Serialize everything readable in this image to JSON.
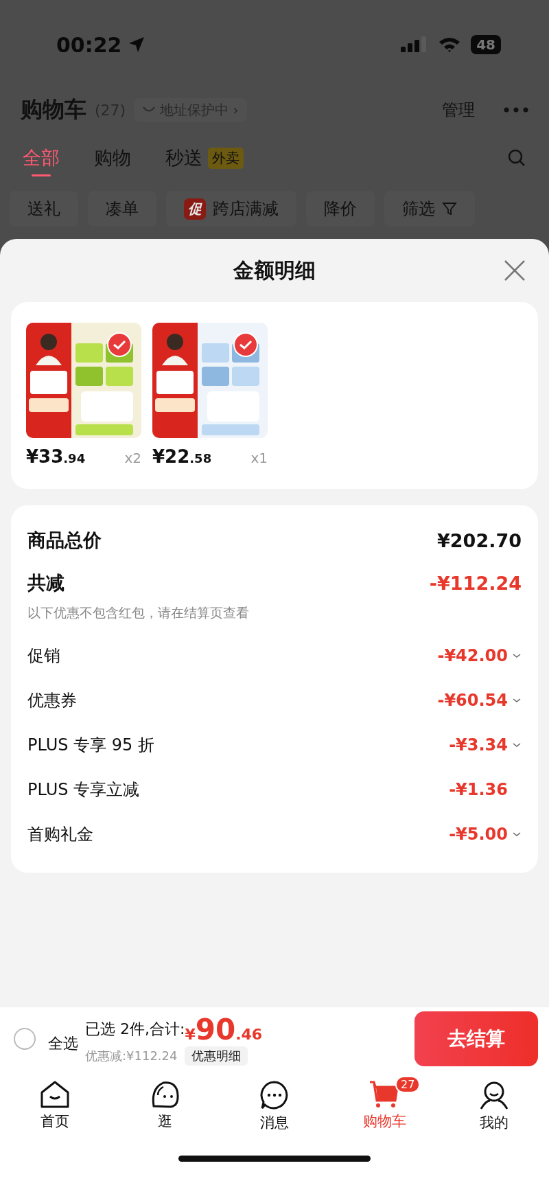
{
  "status_bar": {
    "time": "00:22",
    "battery": "48"
  },
  "header": {
    "title": "购物车",
    "count": "(27)",
    "address": "地址保护中",
    "address_arrow": "›",
    "manage": "管理"
  },
  "tabs": [
    {
      "label": "全部",
      "selected": true
    },
    {
      "label": "购物",
      "selected": false
    },
    {
      "label": "秒送",
      "selected": false,
      "badge": "外卖"
    }
  ],
  "chips": [
    {
      "label": "送礼",
      "kind": "plain"
    },
    {
      "label": "凑单",
      "kind": "plain"
    },
    {
      "label": "跨店满减",
      "kind": "tagged",
      "tag": "促"
    },
    {
      "label": "降价",
      "kind": "plain"
    },
    {
      "label": "筛选",
      "kind": "filter"
    }
  ],
  "sheet": {
    "title": "金额明细",
    "products": [
      {
        "kind": "picture",
        "checked": true,
        "currency": "¥",
        "price": "33",
        "decimal": ".94",
        "qty": "x2"
      },
      {
        "kind": "picture",
        "checked": true,
        "currency": "¥",
        "price": "22",
        "decimal": ".58",
        "qty": "x1"
      }
    ],
    "total": {
      "label": "商品总价",
      "value": "¥202.70"
    },
    "reduction": {
      "label": "共减",
      "value": "-¥112.24",
      "note": "以下优惠不包含红包，请在结算页查看"
    },
    "discounts": [
      {
        "label": "促销",
        "value": "-¥42.00",
        "expandable": true
      },
      {
        "label": "优惠券",
        "value": "-¥60.54",
        "expandable": true
      },
      {
        "label": "PLUS 专享 95 折",
        "value": "-¥3.34",
        "expandable": true
      },
      {
        "label": "PLUS 专享立减",
        "value": "-¥1.36",
        "expandable": false
      },
      {
        "label": "首购礼金",
        "value": "-¥5.00",
        "expandable": true
      }
    ]
  },
  "checkout_bar": {
    "select_all": {
      "label": "全选",
      "checked": false
    },
    "summary": "已选 2件,合计:",
    "currency": "¥",
    "price": "90",
    "decimal": ".46",
    "saved": "优惠减:¥112.24",
    "details_button": "优惠明细",
    "checkout_button": "去结算"
  },
  "nav": [
    {
      "label": "首页",
      "selected": false
    },
    {
      "label": "逛",
      "selected": false
    },
    {
      "label": "消息",
      "selected": false
    },
    {
      "label": "购物车",
      "selected": true,
      "badge": "27"
    },
    {
      "label": "我的",
      "selected": false
    }
  ]
}
